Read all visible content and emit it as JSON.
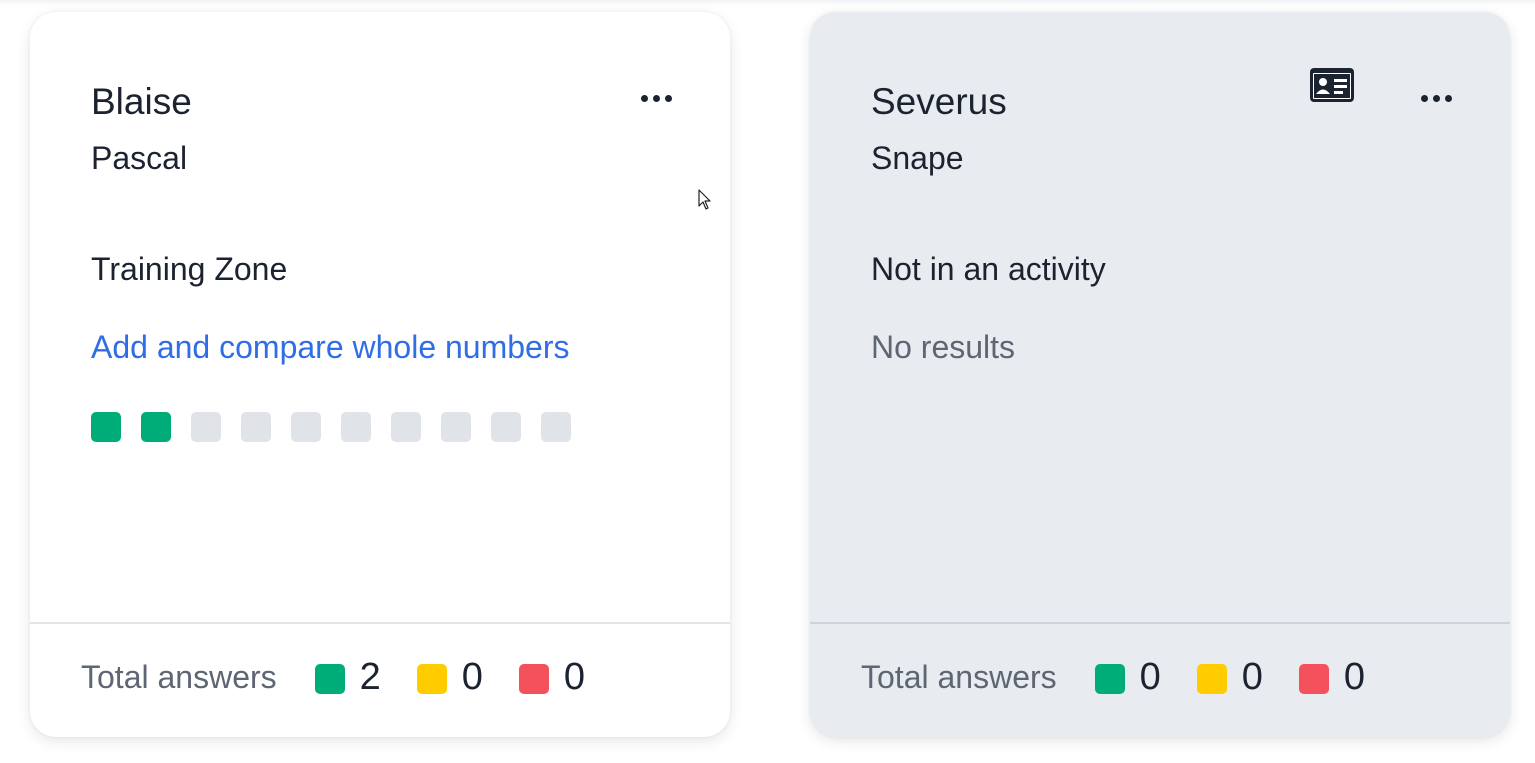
{
  "colors": {
    "correct": "#00ac77",
    "partial": "#ffcc00",
    "incorrect": "#f4515c",
    "pending": "#e0e3e8",
    "link": "#2f6ee6"
  },
  "cards": [
    {
      "first_name": "Blaise",
      "last_name": "Pascal",
      "activity": "Training Zone",
      "topic": "Add and compare whole numbers",
      "progress": [
        "correct",
        "correct",
        "pending",
        "pending",
        "pending",
        "pending",
        "pending",
        "pending",
        "pending",
        "pending"
      ],
      "footer": {
        "label": "Total answers",
        "green": "2",
        "yellow": "0",
        "red": "0"
      },
      "icons": {
        "more": "more-horizontal-icon"
      }
    },
    {
      "first_name": "Severus",
      "last_name": "Snape",
      "activity": "Not in an activity",
      "no_results": "No results",
      "footer": {
        "label": "Total answers",
        "green": "0",
        "yellow": "0",
        "red": "0"
      },
      "icons": {
        "id_card": "id-card-icon",
        "more": "more-horizontal-icon"
      }
    }
  ]
}
